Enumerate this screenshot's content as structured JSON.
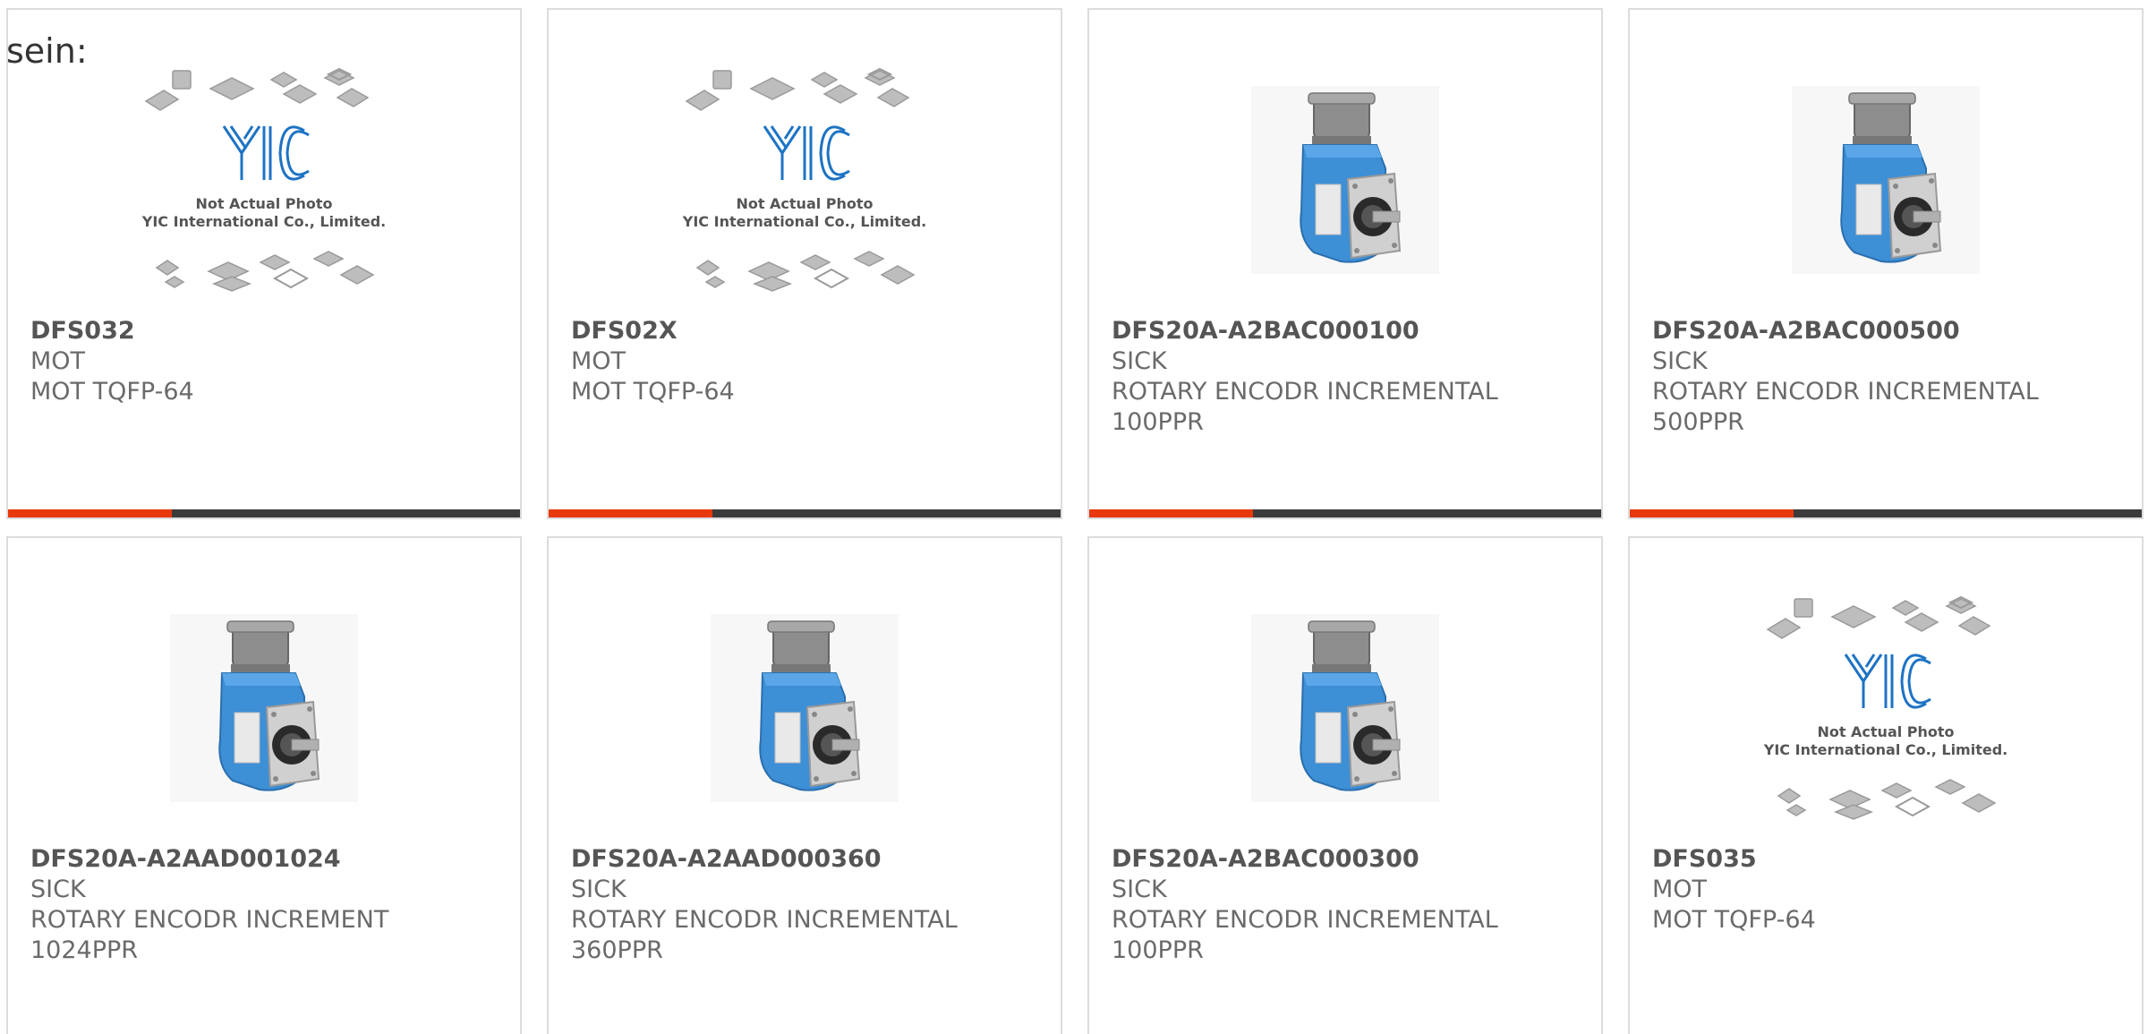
{
  "lead_text": "sein:",
  "colors": {
    "accent_bar": "#e8380d",
    "dark_bar": "#3b3b3b",
    "encoder_blue": "#3d8fd6",
    "placeholder_logo_blue": "#1d73c4"
  },
  "placeholder": {
    "line1": "Not Actual Photo",
    "line2": "YIC International Co., Limited.",
    "logo": "YIC"
  },
  "products": [
    {
      "part": "DFS032",
      "maker": "MOT",
      "desc": "MOT TQFP-64",
      "desc2": "",
      "image": "placeholder"
    },
    {
      "part": "DFS02X",
      "maker": "MOT",
      "desc": "MOT TQFP-64",
      "desc2": "",
      "image": "placeholder"
    },
    {
      "part": "DFS20A-A2BAC000100",
      "maker": "SICK",
      "desc": "ROTARY ENCODR INCREMENTAL",
      "desc2": "100PPR",
      "image": "encoder"
    },
    {
      "part": "DFS20A-A2BAC000500",
      "maker": "SICK",
      "desc": "ROTARY ENCODR INCREMENTAL",
      "desc2": "500PPR",
      "image": "encoder"
    },
    {
      "part": "DFS20A-A2AAD001024",
      "maker": "SICK",
      "desc": "ROTARY ENCODR INCREMENT",
      "desc2": "1024PPR",
      "image": "encoder"
    },
    {
      "part": "DFS20A-A2AAD000360",
      "maker": "SICK",
      "desc": "ROTARY ENCODR INCREMENTAL",
      "desc2": "360PPR",
      "image": "encoder"
    },
    {
      "part": "DFS20A-A2BAC000300",
      "maker": "SICK",
      "desc": "ROTARY ENCODR INCREMENTAL",
      "desc2": "100PPR",
      "image": "encoder"
    },
    {
      "part": "DFS035",
      "maker": "MOT",
      "desc": "MOT TQFP-64",
      "desc2": "",
      "image": "placeholder"
    }
  ]
}
